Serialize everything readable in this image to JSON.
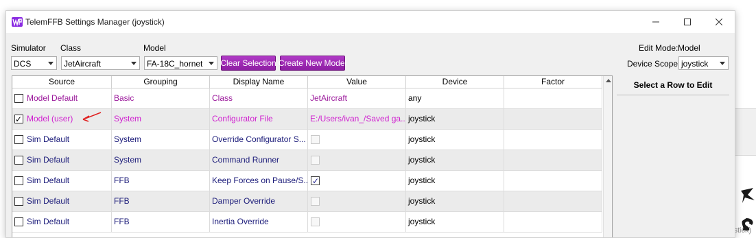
{
  "window": {
    "title": "TelemFFB Settings Manager (joystick)"
  },
  "toolbar": {
    "simulator_label": "Simulator",
    "simulator_value": "DCS",
    "class_label": "Class",
    "class_value": "JetAircraft",
    "model_label": "Model",
    "model_value": "FA-18C_hornet",
    "clear_selection": "Clear Selection",
    "create_new_model": "Create New Model",
    "edit_mode_label": "Edit Mode:",
    "edit_mode_value": "Model",
    "device_scope_label": "Device Scope:",
    "device_scope_value": "joystick"
  },
  "table": {
    "columns": [
      "Source",
      "Grouping",
      "Display Name",
      "Value",
      "Device",
      "Factor"
    ],
    "rows": [
      {
        "checked": false,
        "source": "Model Default",
        "grouping": "Basic",
        "display": "Class",
        "value": "JetAircraft",
        "value_type": "text",
        "device": "any",
        "factor": ""
      },
      {
        "checked": true,
        "source": "Model (user)",
        "grouping": "System",
        "display": "Configurator File",
        "value": "E:/Users/ivan_/Saved ga...",
        "value_type": "text",
        "device": "joystick",
        "factor": ""
      },
      {
        "checked": false,
        "source": "Sim Default",
        "grouping": "System",
        "display": "Override Configurator S...",
        "value": "",
        "value_type": "checkbox",
        "value_checked": false,
        "device": "joystick",
        "factor": ""
      },
      {
        "checked": false,
        "source": "Sim Default",
        "grouping": "System",
        "display": "Command Runner",
        "value": "",
        "value_type": "checkbox",
        "value_checked": false,
        "device": "joystick",
        "factor": ""
      },
      {
        "checked": false,
        "source": "Sim Default",
        "grouping": "FFB",
        "display": "Keep Forces on Pause/S...",
        "value": "",
        "value_type": "checkbox",
        "value_checked": true,
        "device": "joystick",
        "factor": ""
      },
      {
        "checked": false,
        "source": "Sim Default",
        "grouping": "FFB",
        "display": "Damper Override",
        "value": "",
        "value_type": "checkbox",
        "value_checked": false,
        "device": "joystick",
        "factor": ""
      },
      {
        "checked": false,
        "source": "Sim Default",
        "grouping": "FFB",
        "display": "Inertia Override",
        "value": "",
        "value_type": "checkbox",
        "value_checked": false,
        "device": "joystick",
        "factor": ""
      }
    ]
  },
  "side_panel": {
    "header": "Select a Row to Edit"
  },
  "background_app": {
    "fragment": "ystick)"
  },
  "colors": {
    "model_text": "#9b199b",
    "user_text": "#d020d0",
    "sim_text": "#1c1c7a",
    "button_purple": "#9c28b2",
    "annotation_arrow": "#e02020"
  },
  "icons": [
    "telemffb-logo-icon",
    "minimize-icon",
    "maximize-icon",
    "close-icon",
    "dropdown-arrow-icon",
    "scroll-up-icon",
    "red-arrow-annotation-icon"
  ]
}
